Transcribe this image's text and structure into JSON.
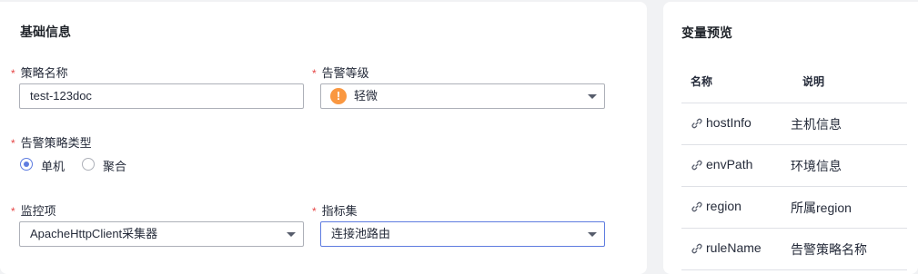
{
  "basic_info": {
    "title": "基础信息",
    "policy_name": {
      "label": "策略名称",
      "value": "test-123doc"
    },
    "alarm_level": {
      "label": "告警等级",
      "value": "轻微"
    },
    "policy_type": {
      "label": "告警策略类型",
      "options": [
        "单机",
        "聚合"
      ],
      "selected": "单机"
    },
    "monitor_item": {
      "label": "监控项",
      "value": "ApacheHttpClient采集器"
    },
    "metric_set": {
      "label": "指标集",
      "value": "连接池路由"
    }
  },
  "variable_preview": {
    "title": "变量预览",
    "columns": [
      "名称",
      "说明"
    ],
    "rows": [
      {
        "name": "hostInfo",
        "desc": "主机信息"
      },
      {
        "name": "envPath",
        "desc": "环境信息"
      },
      {
        "name": "region",
        "desc": "所属region"
      },
      {
        "name": "ruleName",
        "desc": "告警策略名称"
      }
    ]
  },
  "colors": {
    "primary": "#5e7ce0",
    "required": "#e54545",
    "warning": "#fa9841"
  }
}
